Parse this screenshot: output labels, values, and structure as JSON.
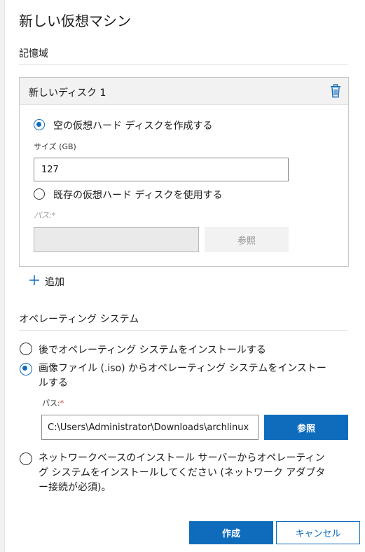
{
  "title": "新しい仮想マシン",
  "storage": {
    "section_label": "記憶域",
    "disk": {
      "header": "新しいディスク 1",
      "option_new_label": "空の仮想ハード ディスクを作成する",
      "size_label": "サイズ (GB)",
      "size_value": "127",
      "option_existing_label": "既存の仮想ハード ディスクを使用する",
      "path_label": "パス:*",
      "path_value": "",
      "browse_label": "参照"
    },
    "add_label": "追加"
  },
  "os": {
    "section_label": "オペレーティング システム",
    "option_later": "後でオペレーティング システムをインストールする",
    "option_iso_line1": "画像ファイル (.iso) からオペレーティング システムをインストー",
    "option_iso_line2": "ルする",
    "path_label": "パス:",
    "path_required": "*",
    "path_value": "C:\\Users\\Administrator\\Downloads\\archlinux",
    "browse_label": "参照",
    "option_network_line1": "ネットワークベースのインストール サーバーからオペレーティン",
    "option_network_line2": "グ システムをインストールしてください (ネットワーク アダプタ",
    "option_network_line3": "ー接続が必須)。"
  },
  "footer": {
    "create_label": "作成",
    "cancel_label": "キャンセル"
  },
  "colors": {
    "accent": "#0f6cbd"
  }
}
